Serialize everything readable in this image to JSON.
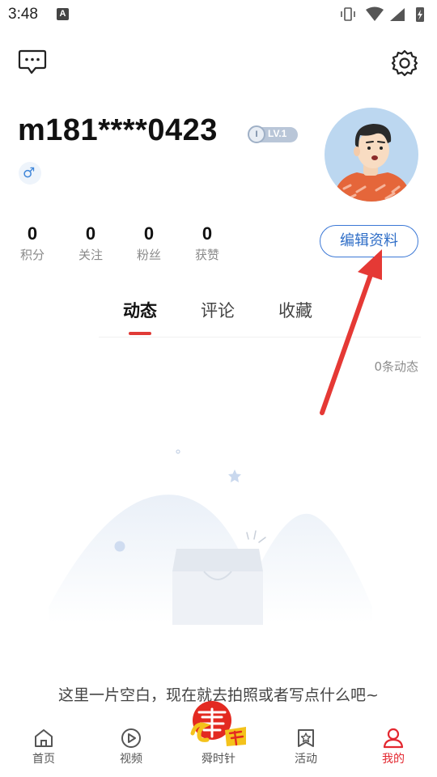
{
  "status_bar": {
    "time": "3:48",
    "notif_glyph": "A"
  },
  "header": {
    "message_icon": "chat-bubble-icon",
    "settings_icon": "gear-icon"
  },
  "profile": {
    "username": "m181****0423",
    "level_icon": "I",
    "level": "LV.1",
    "gender_symbol": "♂",
    "avatar_icon": "cartoon-avatar-icon"
  },
  "stats": [
    {
      "value": "0",
      "label": "积分"
    },
    {
      "value": "0",
      "label": "关注"
    },
    {
      "value": "0",
      "label": "粉丝"
    },
    {
      "value": "0",
      "label": "获赞"
    }
  ],
  "edit_button": "编辑资料",
  "tabs": [
    {
      "label": "动态",
      "active": true
    },
    {
      "label": "评论",
      "active": false
    },
    {
      "label": "收藏",
      "active": false
    }
  ],
  "feed": {
    "count_label": "0条动态",
    "empty_text": "这里一片空白，现在就去拍照或者写点什么吧~"
  },
  "tabbar": [
    {
      "label": "首页",
      "icon": "home-icon",
      "active": false
    },
    {
      "label": "视频",
      "icon": "video-play-icon",
      "active": false
    },
    {
      "label": "舜时针",
      "icon": "shunshizhen-logo-icon",
      "active": false
    },
    {
      "label": "活动",
      "icon": "star-bookmark-icon",
      "active": false
    },
    {
      "label": "我的",
      "icon": "user-icon",
      "active": true
    }
  ],
  "colors": {
    "accent_red": "#e03a36",
    "link_blue": "#2f6ec7",
    "annotation_arrow": "#e53935"
  }
}
